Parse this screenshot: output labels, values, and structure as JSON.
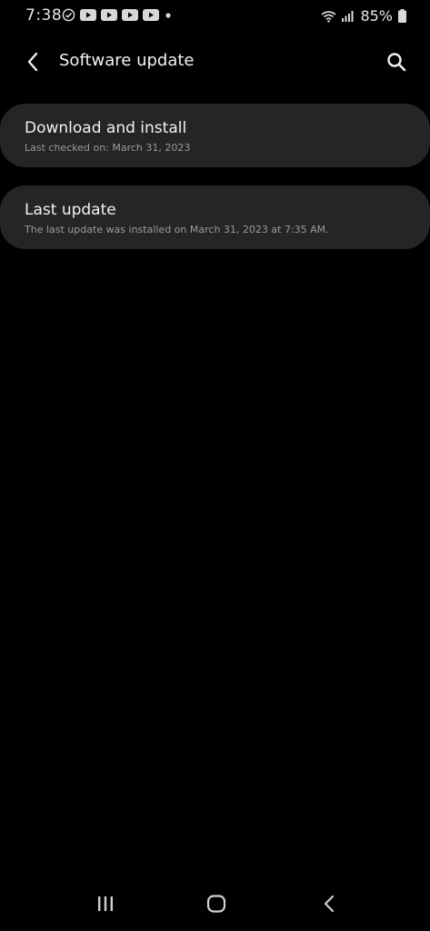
{
  "status_bar": {
    "time": "7:38",
    "battery": "85%",
    "icons": [
      "check-circle-icon",
      "youtube-icon",
      "youtube-icon",
      "youtube-icon",
      "youtube-icon",
      "dot-icon",
      "wifi-icon",
      "signal-icon",
      "battery-icon"
    ]
  },
  "header": {
    "title": "Software update",
    "back_icon": "chevron-left-icon",
    "search_icon": "search-icon"
  },
  "items": [
    {
      "title": "Download and install",
      "subtitle": "Last checked on: March 31, 2023"
    },
    {
      "title": "Last update",
      "subtitle": "The last update was installed on March 31, 2023 at 7:35 AM."
    }
  ],
  "nav_bar": {
    "icons": [
      "recents-icon",
      "home-icon",
      "back-icon"
    ]
  },
  "colors": {
    "background": "#000000",
    "card": "#252525",
    "text_primary": "#f2f2f2",
    "text_secondary": "#9a9a9a"
  }
}
